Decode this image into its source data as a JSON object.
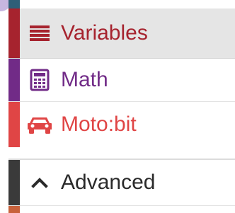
{
  "toolbox": {
    "categories": [
      {
        "id": "variables",
        "label": "Variables",
        "icon": "list-lines-icon",
        "color": "#a6232e",
        "selected": true
      },
      {
        "id": "math",
        "label": "Math",
        "icon": "calculator-icon",
        "color": "#712b87",
        "selected": false
      },
      {
        "id": "motobit",
        "label": "Moto:bit",
        "icon": "car-icon",
        "color": "#e04545",
        "selected": false
      }
    ],
    "advanced": {
      "label": "Advanced",
      "icon": "chevron-up-icon",
      "color": "#3a3a3a"
    }
  },
  "colors": {
    "top_strip": "#2f5f78",
    "bottom_strip": "#c8623c",
    "selected_bg": "#e5e5e5",
    "corner_accent": "#c7b6e0"
  }
}
